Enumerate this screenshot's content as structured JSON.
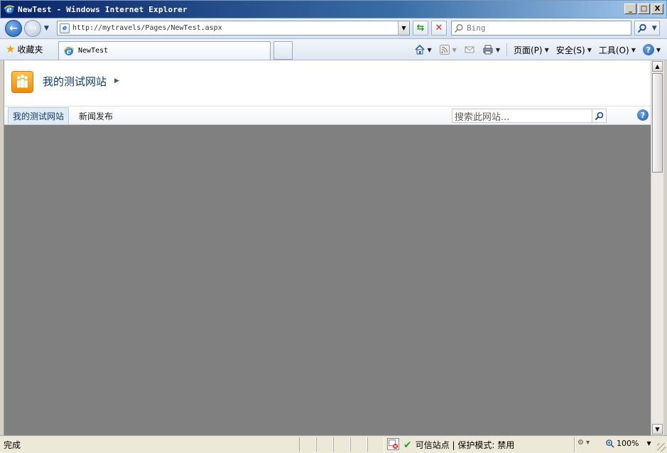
{
  "window": {
    "title": "NewTest - Windows Internet Explorer",
    "minimize": "_",
    "maximize": "□",
    "close": "X"
  },
  "addressbar": {
    "url": "http://mytravels/Pages/NewTest.aspx",
    "search_placeholder": "Bing"
  },
  "favorites": {
    "label": "收藏夹"
  },
  "tab": {
    "label": "NewTest"
  },
  "commandbar": {
    "page_label": "页面(P)",
    "safety_label": "安全(S)",
    "tools_label": "工具(O)",
    "help_symbol": "?"
  },
  "site": {
    "title": "我的测试网站",
    "nav": [
      "我的测试网站",
      "新闻发布"
    ],
    "search_placeholder": "搜索此网站...",
    "help_symbol": "?"
  },
  "statusbar": {
    "status": "完成",
    "zone": "可信站点 | 保护模式: 禁用",
    "zoom": "100%"
  },
  "colors": {
    "content_bg": "#808080",
    "titlebar_start": "#0a246a",
    "link_blue": "#0c3a6b",
    "logo_orange": "#f08a00"
  }
}
